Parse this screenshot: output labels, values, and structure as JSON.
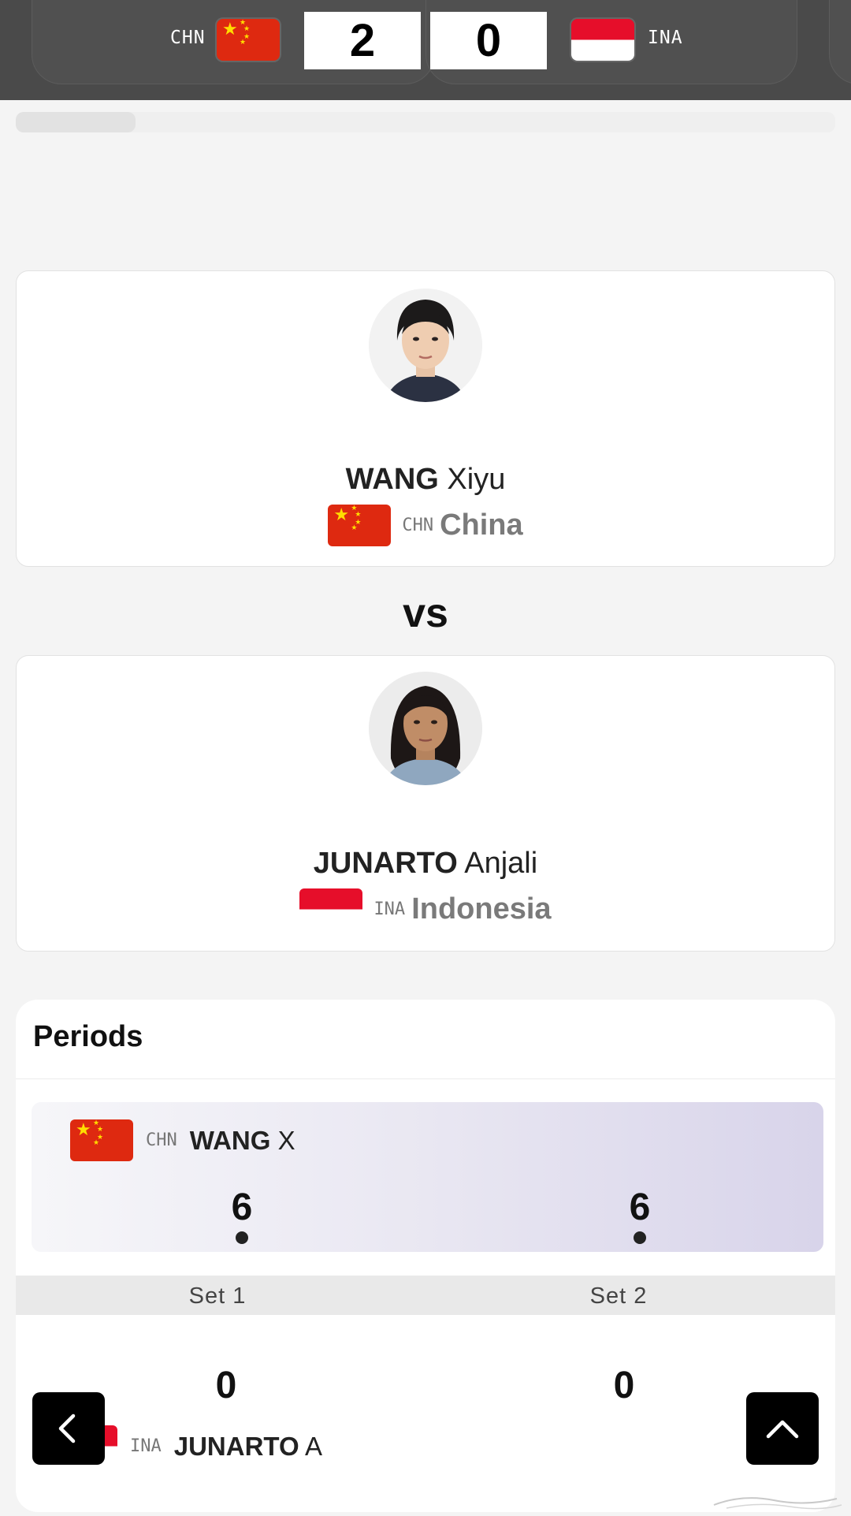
{
  "scoreboard": {
    "home_code": "CHN",
    "away_code": "INA",
    "home_score": "2",
    "away_score": "0"
  },
  "players": [
    {
      "surname": "WANG",
      "given": "Xiyu",
      "country_code": "CHN",
      "country": "China"
    },
    {
      "surname": "JUNARTO",
      "given": "Anjali",
      "country_code": "INA",
      "country": "Indonesia"
    }
  ],
  "vs_label": "vs",
  "periods": {
    "title": "Periods",
    "player_a": {
      "code": "CHN",
      "surname": "WANG",
      "initial": "X",
      "sets": [
        "6",
        "6"
      ]
    },
    "player_b": {
      "code": "INA",
      "surname": "JUNARTO",
      "initial": "A",
      "sets": [
        "0",
        "0"
      ]
    },
    "set_labels": [
      "Set 1",
      "Set 2"
    ]
  },
  "icons": {
    "back": "chevron-left-icon",
    "scroll_top": "chevron-up-icon"
  },
  "colors": {
    "china_red": "#de2910",
    "china_yellow": "#ffde00",
    "indonesia_red": "#e60e2a",
    "topbar": "#4a4a4a",
    "row_highlight": "#d8d4ea"
  }
}
